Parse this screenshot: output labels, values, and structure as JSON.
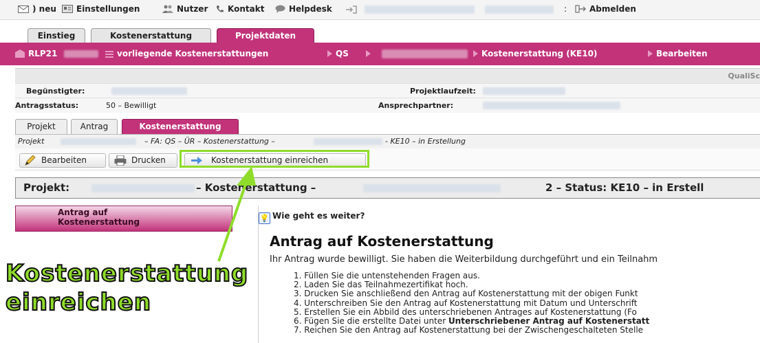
{
  "topnav": {
    "items": [
      {
        "label": ") neu",
        "icon": "mail-icon"
      },
      {
        "label": "Einstellungen",
        "icon": "settings-icon"
      },
      {
        "label": "Nutzer",
        "icon": "users-icon"
      },
      {
        "label": "Kontakt",
        "icon": "phone-icon"
      },
      {
        "label": "Helpdesk",
        "icon": "chat-icon"
      }
    ],
    "separator": ":",
    "logout": "Abmelden"
  },
  "main_tabs": [
    "Einstieg",
    "Kostenerstattung",
    "Projektdaten"
  ],
  "project_bar": {
    "project": "RLP21",
    "list_link": "vorliegende Kostenerstattungen",
    "qs": "QS",
    "current": "Kostenerstattung (KE10)",
    "action": "Bearbeiten"
  },
  "info": {
    "qs_label": "QualiSc",
    "beguenstigter_label": "Begünstigter:",
    "projektlaufzeit_label": "Projektlaufzeit:",
    "antragsstatus_label": "Antragsstatus:",
    "antragsstatus_value": "50 – Bewilligt",
    "ansprechpartner_label": "Ansprechpartner:"
  },
  "sub_tabs": [
    "Projekt",
    "Antrag",
    "Kostenerstattung"
  ],
  "breadcrumb": {
    "part1": "Projekt",
    "part2": "– FA: QS – ÜR – Kostenerstattung –",
    "part3": "- KE10 – in Erstellung"
  },
  "toolbar": {
    "edit": "Bearbeiten",
    "print": "Drucken",
    "submit": "Kostenerstattung einreichen"
  },
  "status_line": {
    "part1": "Projekt:",
    "part2": "– Kostenerstattung –",
    "part3": "2 – Status: KE10 – in Erstell"
  },
  "sidebar": {
    "button_line1": "Antrag auf",
    "button_line2": "Kostenerstattung"
  },
  "content": {
    "hint": "Wie geht es weiter?",
    "title": "Antrag auf Kostenerstattung",
    "intro": "Ihr Antrag wurde bewilligt. Sie haben die Weiterbildung durchgeführt und ein Teilnahm",
    "steps": [
      "1. Füllen Sie die untenstehenden Fragen aus.",
      "2. Laden Sie das Teilnahmezertifikat hoch.",
      "3. Drucken Sie anschließend den Antrag auf Kostenerstattung mit der obigen Funkt",
      "4. Unterschreiben Sie den Antrag auf Kostenerstattung mit Datum und Unterschrift",
      "5. Erstellen Sie ein Abbild des unterschriebenen Antrages auf Kostenerstattung (Fo",
      "6. Fügen Sie die erstellte Datei unter ",
      "7. Reichen Sie den Antrag auf Kostenerstattung bei der Zwischengeschalteten Stelle"
    ],
    "step6_bold": "Unterschriebener Antrag auf Kostenerstatt"
  },
  "annotation": {
    "line1": "Kostenerstattung",
    "line2": "einreichen",
    "color": "#8fdc2a"
  }
}
